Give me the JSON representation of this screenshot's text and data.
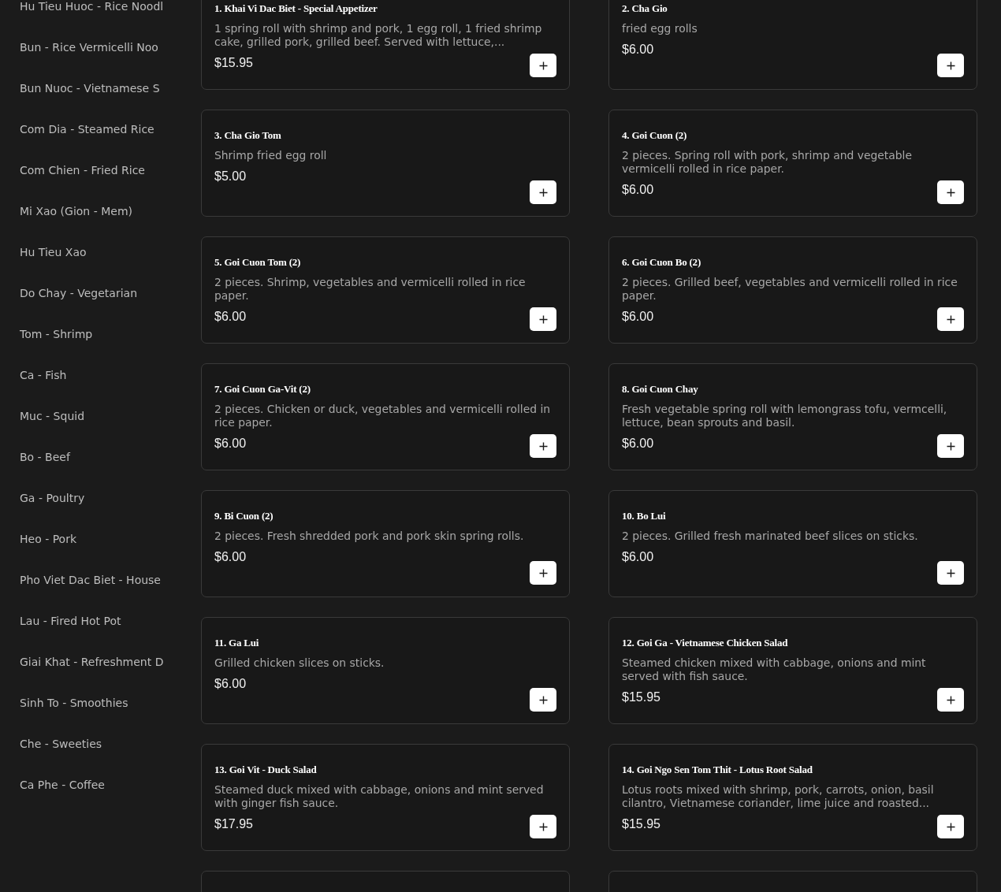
{
  "sidebar": {
    "categories": [
      {
        "label": "Hu Tieu Huoc - Rice Noodl",
        "selected": false
      },
      {
        "label": "Bun - Rice Vermicelli Noo",
        "selected": false
      },
      {
        "label": "Bun Nuoc - Vietnamese S",
        "selected": false
      },
      {
        "label": "Com Dia - Steamed Rice",
        "selected": false
      },
      {
        "label": "Com Chien - Fried Rice",
        "selected": false
      },
      {
        "label": "Mi Xao (Gion - Mem)",
        "selected": false
      },
      {
        "label": "Hu Tieu Xao",
        "selected": false
      },
      {
        "label": "Do Chay - Vegetarian",
        "selected": false
      },
      {
        "label": "Tom - Shrimp",
        "selected": false
      },
      {
        "label": "Ca - Fish",
        "selected": false
      },
      {
        "label": "Muc - Squid",
        "selected": false
      },
      {
        "label": "Bo - Beef",
        "selected": false
      },
      {
        "label": "Ga - Poultry",
        "selected": false
      },
      {
        "label": "Heo - Pork",
        "selected": false
      },
      {
        "label": "Pho Viet Dac Biet - House",
        "selected": false
      },
      {
        "label": "Lau - Fired Hot Pot",
        "selected": false
      },
      {
        "label": "Giai Khat - Refreshment D",
        "selected": false
      },
      {
        "label": "Sinh To - Smoothies",
        "selected": false
      },
      {
        "label": "Che - Sweeties",
        "selected": false
      },
      {
        "label": "Ca Phe - Coffee",
        "selected": false
      }
    ]
  },
  "menu": {
    "items": [
      {
        "kind": "dish",
        "title": "1. Khai Vi Dac Biet - Special Appetizer",
        "description": "1 spring roll with shrimp and pork, 1 egg roll, 1 fried shrimp cake, grilled pork, grilled beef. Served with lettuce,...",
        "price": "$15.95"
      },
      {
        "kind": "dish",
        "title": "2. Cha Gio",
        "description": "fried egg rolls",
        "price": "$6.00"
      },
      {
        "kind": "dish",
        "title": "3. Cha Gio Tom",
        "description": "Shrimp fried egg roll",
        "price": "$5.00"
      },
      {
        "kind": "dish",
        "title": "4. Goi Cuon (2)",
        "description": "2 pieces. Spring roll with pork, shrimp and vegetable vermicelli rolled in rice paper.",
        "price": "$6.00"
      },
      {
        "kind": "dish",
        "title": "5. Goi Cuon Tom (2)",
        "description": "2 pieces. Shrimp, vegetables and vermicelli rolled in rice paper.",
        "price": "$6.00"
      },
      {
        "kind": "dish",
        "title": "6. Goi Cuon Bo (2)",
        "description": "2 pieces. Grilled beef, vegetables and vermicelli rolled in rice paper.",
        "price": "$6.00"
      },
      {
        "kind": "dish",
        "title": "7. Goi Cuon Ga-Vit (2)",
        "description": "2 pieces. Chicken or duck, vegetables and vermicelli rolled in rice paper.",
        "price": "$6.00"
      },
      {
        "kind": "dish",
        "title": "8. Goi Cuon Chay",
        "description": "Fresh vegetable spring roll with lemongrass tofu, vermcelli, lettuce, bean sprouts and basil.",
        "price": "$6.00"
      },
      {
        "kind": "dish",
        "title": "9. Bi Cuon (2)",
        "description": "2 pieces. Fresh shredded pork and pork skin spring rolls.",
        "price": "$6.00"
      },
      {
        "kind": "dish",
        "title": "10. Bo Lui",
        "description": "2 pieces. Grilled fresh marinated beef slices on sticks.",
        "price": "$6.00"
      },
      {
        "kind": "dish",
        "title": "11. Ga Lui",
        "description": "Grilled chicken slices on sticks.",
        "price": "$6.00"
      },
      {
        "kind": "dish",
        "title": "12. Goi Ga - Vietnamese Chicken Salad",
        "description": "Steamed chicken mixed with cabbage, onions and mint served with fish sauce.",
        "price": "$15.95"
      },
      {
        "kind": "dish",
        "title": "13. Goi Vit - Duck Salad",
        "description": "Steamed duck mixed with cabbage, onions and mint served with ginger fish sauce.",
        "price": "$17.95"
      },
      {
        "kind": "dish",
        "title": "14. Goi Ngo Sen Tom Thit - Lotus Root Salad",
        "description": "Lotus roots mixed with shrimp, pork, carrots, onion, basil cilantro, Vietnamese coriander, lime juice and roasted...",
        "price": "$15.95"
      },
      {
        "kind": "cut"
      },
      {
        "kind": "cut"
      }
    ]
  }
}
